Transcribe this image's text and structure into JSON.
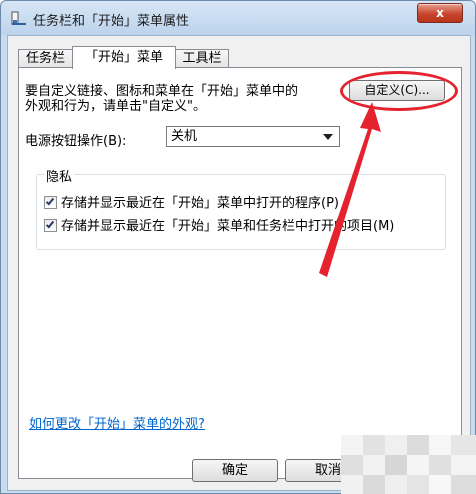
{
  "window": {
    "title": "任务栏和「开始」菜单属性",
    "close_label": "x"
  },
  "tabs": [
    {
      "label": "任务栏",
      "active": false
    },
    {
      "label": "「开始」菜单",
      "active": true
    },
    {
      "label": "工具栏",
      "active": false
    }
  ],
  "panel": {
    "description": "要自定义链接、图标和菜单在「开始」菜单中的\n外观和行为，请单击\"自定义\"。",
    "customize_label": "自定义(C)...",
    "power_label": "电源按钮操作(B):",
    "power_value": "关机",
    "privacy": {
      "legend": "隐私",
      "options": [
        {
          "label": "存储并显示最近在「开始」菜单中打开的程序(P)",
          "checked": true
        },
        {
          "label": "存储并显示最近在「开始」菜单和任务栏中打开的项目(M)",
          "checked": true
        }
      ]
    },
    "help_link": "如何更改「开始」菜单的外观?"
  },
  "buttons": {
    "ok": "确定",
    "cancel": "取消"
  },
  "colors": {
    "highlight": "#e4232f",
    "link": "#0066cc"
  }
}
